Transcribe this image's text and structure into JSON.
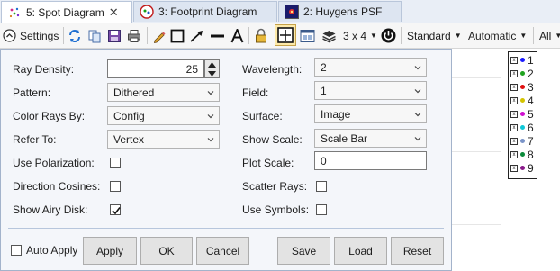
{
  "tabs": [
    {
      "label": "5: Spot Diagram",
      "close": "✕",
      "active": true
    },
    {
      "label": "3: Footprint Diagram",
      "active": false
    },
    {
      "label": "2: Huygens PSF",
      "active": false
    }
  ],
  "toolbar": {
    "settings_label": "Settings",
    "layout_label": "3 x 4",
    "standard_label": "Standard",
    "automatic_label": "Automatic",
    "all_label": "All"
  },
  "legend": {
    "items": [
      {
        "label": "1",
        "color": "#1a1aff"
      },
      {
        "label": "2",
        "color": "#1fa31f"
      },
      {
        "label": "3",
        "color": "#e01010"
      },
      {
        "label": "4",
        "color": "#d4c400"
      },
      {
        "label": "5",
        "color": "#d010d0"
      },
      {
        "label": "6",
        "color": "#10c8d8"
      },
      {
        "label": "7",
        "color": "#7a94c8"
      },
      {
        "label": "8",
        "color": "#0a8a3a"
      },
      {
        "label": "9",
        "color": "#8a1a8a"
      }
    ]
  },
  "settings": {
    "ray_density": {
      "label": "Ray Density:",
      "value": "25"
    },
    "pattern": {
      "label": "Pattern:",
      "value": "Dithered"
    },
    "color_rays_by": {
      "label": "Color Rays By:",
      "value": "Config"
    },
    "refer_to": {
      "label": "Refer To:",
      "value": "Vertex"
    },
    "use_polarization": {
      "label": "Use Polarization:",
      "checked": false
    },
    "direction_cosines": {
      "label": "Direction Cosines:",
      "checked": false
    },
    "show_airy_disk": {
      "label": "Show Airy Disk:",
      "checked": true
    },
    "wavelength": {
      "label": "Wavelength:",
      "value": "2"
    },
    "field": {
      "label": "Field:",
      "value": "1"
    },
    "surface": {
      "label": "Surface:",
      "value": "Image"
    },
    "show_scale": {
      "label": "Show Scale:",
      "value": "Scale Bar"
    },
    "plot_scale": {
      "label": "Plot Scale:",
      "value": "0"
    },
    "scatter_rays": {
      "label": "Scatter Rays:",
      "checked": false
    },
    "use_symbols": {
      "label": "Use Symbols:",
      "checked": false
    },
    "auto_apply": {
      "label": "Auto Apply",
      "checked": false
    }
  },
  "buttons": {
    "apply": "Apply",
    "ok": "OK",
    "cancel": "Cancel",
    "save": "Save",
    "load": "Load",
    "reset": "Reset"
  },
  "colors": {
    "accent": "#1f6fd1",
    "panel_bg": "#f4f6fa",
    "panel_border": "#a3b3cb"
  }
}
